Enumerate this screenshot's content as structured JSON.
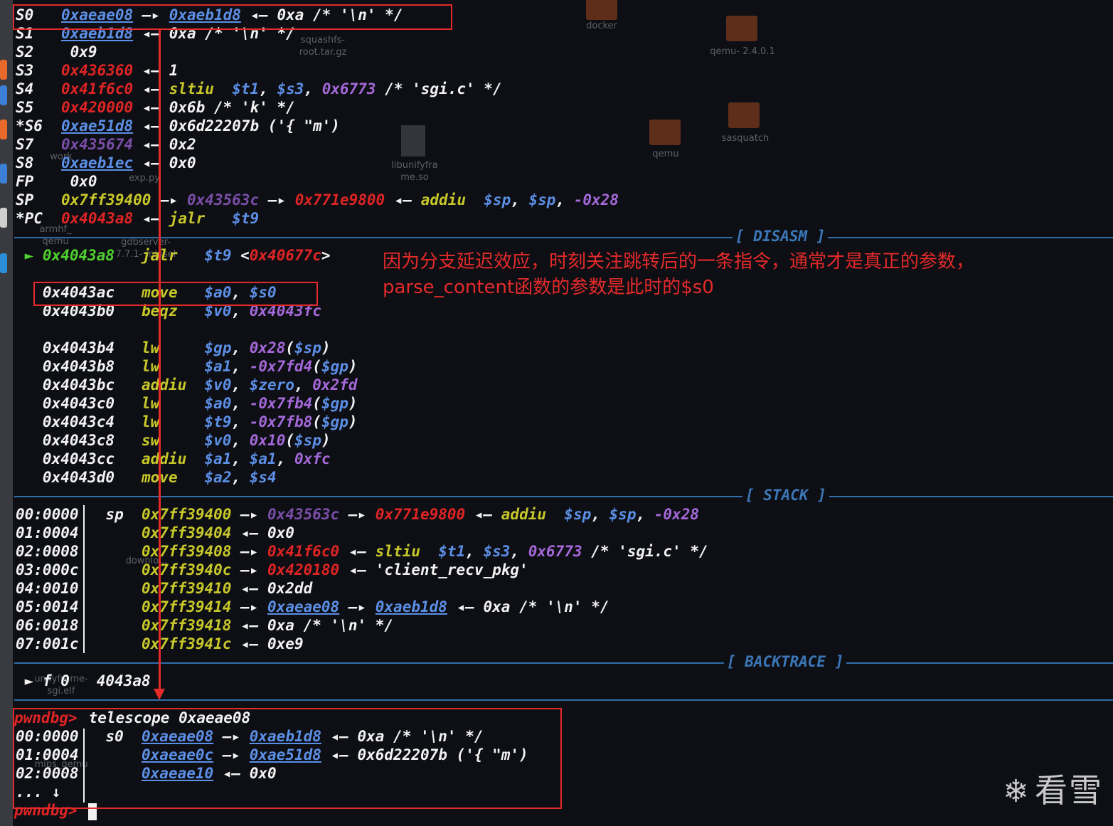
{
  "registers": [
    {
      "name": "S0",
      "value": "0xaeae08",
      "rest": [
        [
          "w",
          " "
        ],
        [
          "bu",
          "0xaeae08"
        ],
        [
          "w",
          " —▸ "
        ],
        [
          "bu",
          "0xaeb1d8"
        ],
        [
          "w",
          " ◂— 0xa /* '\\n' */"
        ]
      ]
    },
    {
      "name": "S1",
      "rest": [
        [
          "w",
          " "
        ],
        [
          "bu",
          "0xaeb1d8"
        ],
        [
          "w",
          " ◂— 0xa /* '\\n' */"
        ]
      ]
    },
    {
      "name": "S2",
      "rest": [
        [
          "w",
          " 0x9"
        ]
      ]
    },
    {
      "name": "S3",
      "rest": [
        [
          "w",
          " "
        ],
        [
          "r",
          "0x436360"
        ],
        [
          "w",
          " ◂— 1"
        ]
      ]
    },
    {
      "name": "S4",
      "rest": [
        [
          "w",
          " "
        ],
        [
          "r",
          "0x41f6c0"
        ],
        [
          "w",
          " ◂— "
        ],
        [
          "y",
          "sltiu  "
        ],
        [
          "b",
          "$t1"
        ],
        [
          "w",
          ", "
        ],
        [
          "b",
          "$s3"
        ],
        [
          "w",
          ", "
        ],
        [
          "p",
          "0x6773"
        ],
        [
          "w",
          " /* 'sgi.c' */"
        ]
      ]
    },
    {
      "name": "S5",
      "rest": [
        [
          "w",
          " "
        ],
        [
          "r",
          "0x420000"
        ],
        [
          "w",
          " ◂— 0x6b /* 'k' */"
        ]
      ]
    },
    {
      "name": "*S6",
      "rest": [
        [
          "w",
          " "
        ],
        [
          "bu",
          "0xae51d8"
        ],
        [
          "w",
          " ◂— 0x6d22207b ('{ \"m')"
        ]
      ]
    },
    {
      "name": "S7",
      "rest": [
        [
          "w",
          " "
        ],
        [
          "dp",
          "0x435674"
        ],
        [
          "w",
          " ◂— 0x2"
        ]
      ]
    },
    {
      "name": "S8",
      "rest": [
        [
          "w",
          " "
        ],
        [
          "bu",
          "0xaeb1ec"
        ],
        [
          "w",
          " ◂— 0x0"
        ]
      ]
    },
    {
      "name": "FP",
      "rest": [
        [
          "w",
          " 0x0"
        ]
      ]
    },
    {
      "name": "SP",
      "rest": [
        [
          "w",
          " "
        ],
        [
          "y",
          "0x7ff39400"
        ],
        [
          "w",
          " —▸ "
        ],
        [
          "dp",
          "0x43563c"
        ],
        [
          "w",
          " —▸ "
        ],
        [
          "r",
          "0x771e9800"
        ],
        [
          "w",
          " ◂— "
        ],
        [
          "y",
          "addiu  "
        ],
        [
          "b",
          "$sp"
        ],
        [
          "w",
          ", "
        ],
        [
          "b",
          "$sp"
        ],
        [
          "w",
          ", "
        ],
        [
          "p",
          "-0x28"
        ]
      ]
    },
    {
      "name": "*PC",
      "rest": [
        [
          "w",
          " "
        ],
        [
          "r",
          "0x4043a8"
        ],
        [
          "w",
          " ◂— "
        ],
        [
          "y",
          "jalr   "
        ],
        [
          "b",
          "$t9"
        ]
      ]
    }
  ],
  "sections": {
    "disasm": "[ DISASM ]",
    "stack": "[ STACK ]",
    "backtrace": "[ BACKTRACE ]"
  },
  "disasm": [
    [
      [
        "g",
        " ► 0x4043a8   "
      ],
      [
        "y",
        "jalr   "
      ],
      [
        "b",
        "$t9 "
      ],
      [
        "w",
        "<"
      ],
      [
        "r",
        "0x40677c"
      ],
      [
        "w",
        ">"
      ]
    ],
    [],
    [
      [
        "w",
        "   0x4043ac   "
      ],
      [
        "y",
        "move   "
      ],
      [
        "b",
        "$a0"
      ],
      [
        "w",
        ", "
      ],
      [
        "b",
        "$s0"
      ]
    ],
    [
      [
        "w",
        "   0x4043b0   "
      ],
      [
        "y",
        "beqz   "
      ],
      [
        "b",
        "$v0"
      ],
      [
        "w",
        ", "
      ],
      [
        "p",
        "0x4043fc"
      ]
    ],
    [],
    [
      [
        "w",
        "   0x4043b4   "
      ],
      [
        "y",
        "lw     "
      ],
      [
        "b",
        "$gp"
      ],
      [
        "w",
        ", "
      ],
      [
        "p",
        "0x28"
      ],
      [
        "w",
        "("
      ],
      [
        "b",
        "$sp"
      ],
      [
        "w",
        ")"
      ]
    ],
    [
      [
        "w",
        "   0x4043b8   "
      ],
      [
        "y",
        "lw     "
      ],
      [
        "b",
        "$a1"
      ],
      [
        "w",
        ", "
      ],
      [
        "p",
        "-0x7fd4"
      ],
      [
        "w",
        "("
      ],
      [
        "b",
        "$gp"
      ],
      [
        "w",
        ")"
      ]
    ],
    [
      [
        "w",
        "   0x4043bc   "
      ],
      [
        "y",
        "addiu  "
      ],
      [
        "b",
        "$v0"
      ],
      [
        "w",
        ", "
      ],
      [
        "b",
        "$zero"
      ],
      [
        "w",
        ", "
      ],
      [
        "p",
        "0x2fd"
      ]
    ],
    [
      [
        "w",
        "   0x4043c0   "
      ],
      [
        "y",
        "lw     "
      ],
      [
        "b",
        "$a0"
      ],
      [
        "w",
        ", "
      ],
      [
        "p",
        "-0x7fb4"
      ],
      [
        "w",
        "("
      ],
      [
        "b",
        "$gp"
      ],
      [
        "w",
        ")"
      ]
    ],
    [
      [
        "w",
        "   0x4043c4   "
      ],
      [
        "y",
        "lw     "
      ],
      [
        "b",
        "$t9"
      ],
      [
        "w",
        ", "
      ],
      [
        "p",
        "-0x7fb8"
      ],
      [
        "w",
        "("
      ],
      [
        "b",
        "$gp"
      ],
      [
        "w",
        ")"
      ]
    ],
    [
      [
        "w",
        "   0x4043c8   "
      ],
      [
        "y",
        "sw     "
      ],
      [
        "b",
        "$v0"
      ],
      [
        "w",
        ", "
      ],
      [
        "p",
        "0x10"
      ],
      [
        "w",
        "("
      ],
      [
        "b",
        "$sp"
      ],
      [
        "w",
        ")"
      ]
    ],
    [
      [
        "w",
        "   0x4043cc   "
      ],
      [
        "y",
        "addiu  "
      ],
      [
        "b",
        "$a1"
      ],
      [
        "w",
        ", "
      ],
      [
        "b",
        "$a1"
      ],
      [
        "w",
        ", "
      ],
      [
        "p",
        "0xfc"
      ]
    ],
    [
      [
        "w",
        "   0x4043d0   "
      ],
      [
        "y",
        "move   "
      ],
      [
        "b",
        "$a2"
      ],
      [
        "w",
        ", "
      ],
      [
        "b",
        "$s4"
      ]
    ]
  ],
  "annotation": "因为分支延迟效应，时刻关注跳转后的一条指令，通常才是真正的参数，\nparse_content函数的参数是此时的$s0",
  "stack": [
    [
      [
        "w",
        "00:0000 "
      ],
      [
        "w",
        "  sp  "
      ],
      [
        "y",
        "0x7ff39400"
      ],
      [
        "w",
        " —▸ "
      ],
      [
        "dp",
        "0x43563c"
      ],
      [
        "w",
        " —▸ "
      ],
      [
        "r",
        "0x771e9800"
      ],
      [
        "w",
        " ◂— "
      ],
      [
        "y",
        "addiu  "
      ],
      [
        "b",
        "$sp"
      ],
      [
        "w",
        ", "
      ],
      [
        "b",
        "$sp"
      ],
      [
        "w",
        ", "
      ],
      [
        "p",
        "-0x28"
      ]
    ],
    [
      [
        "w",
        "01:0004 "
      ],
      [
        "w",
        "      "
      ],
      [
        "y",
        "0x7ff39404"
      ],
      [
        "w",
        " ◂— 0x0"
      ]
    ],
    [
      [
        "w",
        "02:0008 "
      ],
      [
        "w",
        "      "
      ],
      [
        "y",
        "0x7ff39408"
      ],
      [
        "w",
        " —▸ "
      ],
      [
        "r",
        "0x41f6c0"
      ],
      [
        "w",
        " ◂— "
      ],
      [
        "y",
        "sltiu  "
      ],
      [
        "b",
        "$t1"
      ],
      [
        "w",
        ", "
      ],
      [
        "b",
        "$s3"
      ],
      [
        "w",
        ", "
      ],
      [
        "p",
        "0x6773"
      ],
      [
        "w",
        " /* 'sgi.c' */"
      ]
    ],
    [
      [
        "w",
        "03:000c "
      ],
      [
        "w",
        "      "
      ],
      [
        "y",
        "0x7ff3940c"
      ],
      [
        "w",
        " —▸ "
      ],
      [
        "r",
        "0x420180"
      ],
      [
        "w",
        " ◂— 'client_recv_pkg'"
      ]
    ],
    [
      [
        "w",
        "04:0010 "
      ],
      [
        "w",
        "      "
      ],
      [
        "y",
        "0x7ff39410"
      ],
      [
        "w",
        " ◂— 0x2dd"
      ]
    ],
    [
      [
        "w",
        "05:0014 "
      ],
      [
        "w",
        "      "
      ],
      [
        "y",
        "0x7ff39414"
      ],
      [
        "w",
        " —▸ "
      ],
      [
        "bu",
        "0xaeae08"
      ],
      [
        "w",
        " —▸ "
      ],
      [
        "bu",
        "0xaeb1d8"
      ],
      [
        "w",
        " ◂— 0xa /* '\\n' */"
      ]
    ],
    [
      [
        "w",
        "06:0018 "
      ],
      [
        "w",
        "      "
      ],
      [
        "y",
        "0x7ff39418"
      ],
      [
        "w",
        " ◂— 0xa /* '\\n' */"
      ]
    ],
    [
      [
        "w",
        "07:001c "
      ],
      [
        "w",
        "      "
      ],
      [
        "y",
        "0x7ff3941c"
      ],
      [
        "w",
        " ◂— 0xe9"
      ]
    ]
  ],
  "backtrace": [
    [
      "w",
      " ► f 0   4043a8"
    ]
  ],
  "prompt": "pwndbg>",
  "command": " telescope 0xaeae08",
  "telescope": [
    [
      [
        "w",
        "00:0000 "
      ],
      [
        "w",
        "  s0  "
      ],
      [
        "bu",
        "0xaeae08"
      ],
      [
        "w",
        " —▸ "
      ],
      [
        "bu",
        "0xaeb1d8"
      ],
      [
        "w",
        " ◂— 0xa /* '\\n' */"
      ]
    ],
    [
      [
        "w",
        "01:0004 "
      ],
      [
        "w",
        "      "
      ],
      [
        "bu",
        "0xaeae0c"
      ],
      [
        "w",
        " —▸ "
      ],
      [
        "bu",
        "0xae51d8"
      ],
      [
        "w",
        " ◂— 0x6d22207b ('{ \"m')"
      ]
    ],
    [
      [
        "w",
        "02:0008 "
      ],
      [
        "w",
        "      "
      ],
      [
        "bu",
        "0xaeae10"
      ],
      [
        "w",
        " ◂— 0x0"
      ]
    ],
    [
      [
        "w",
        "... ↓"
      ]
    ]
  ],
  "desktop_icons": [
    {
      "label": "docker"
    },
    {
      "label": "qemu-\n2.4.0.1"
    },
    {
      "label": "squashfs-\nroot.tar.gz"
    },
    {
      "label": "sasquatch"
    },
    {
      "label": "qemu"
    },
    {
      "label": "libunifyfra\nme.so"
    },
    {
      "label": "work"
    },
    {
      "label": "exp.py"
    },
    {
      "label": "armhf_\nqemu"
    },
    {
      "label": "gdbserver-\n7.7.1-\nmipsel"
    },
    {
      "label": "downlo..."
    },
    {
      "label": "unifyframe-\nsgi.elf"
    },
    {
      "label": "mips_qemu"
    }
  ],
  "watermark": "看雪",
  "watermark_icon": "snowflake-icon",
  "colors": {
    "background": "#0d0f14",
    "register": "#f2f2f2",
    "stack_addr": "#c8c82a",
    "heap_link": "#5c8fe6",
    "code_addr": "#e02424",
    "immediate": "#a468d8",
    "current_pc": "#4fd12e",
    "separator": "#2f6ca8",
    "annotation_red": "#e52a2a"
  }
}
